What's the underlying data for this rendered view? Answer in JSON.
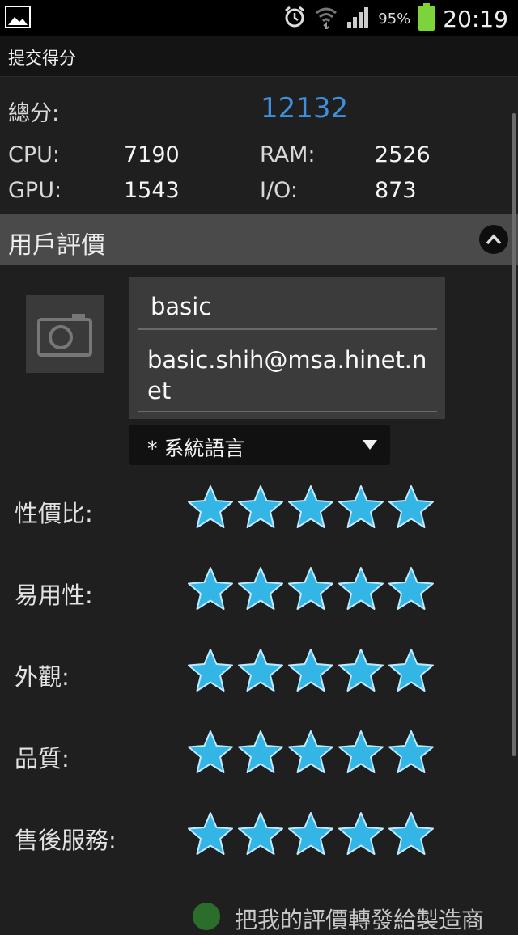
{
  "status_bar": {
    "battery_text": "95%",
    "time": "20:19",
    "icons": [
      "gallery-icon",
      "alarm-icon",
      "wifi-icon",
      "signal-icon",
      "battery-icon"
    ]
  },
  "title_bar": {
    "title": "提交得分"
  },
  "scores": {
    "total_label": "總分:",
    "total_value": "12132",
    "cpu_label": "CPU:",
    "cpu_value": "7190",
    "ram_label": "RAM:",
    "ram_value": "2526",
    "gpu_label": "GPU:",
    "gpu_value": "1543",
    "io_label": "I/O:",
    "io_value": "873"
  },
  "review_section": {
    "title": "用戶評價",
    "name_value": "basic",
    "email_value": "basic.shih@msa.hinet.net",
    "language_selected": "* 系統語言"
  },
  "ratings": [
    {
      "label": "性價比:",
      "stars": 5
    },
    {
      "label": "易用性:",
      "stars": 5
    },
    {
      "label": "外觀:",
      "stars": 5
    },
    {
      "label": "品質:",
      "stars": 5
    },
    {
      "label": "售後服務:",
      "stars": 5
    }
  ],
  "share": {
    "text": "把我的評價轉發給製造商"
  },
  "colors": {
    "accent": "#3d8fe0",
    "star": "#33b5e5",
    "background": "#1f1f1f",
    "section_header": "#4a4a4a"
  }
}
